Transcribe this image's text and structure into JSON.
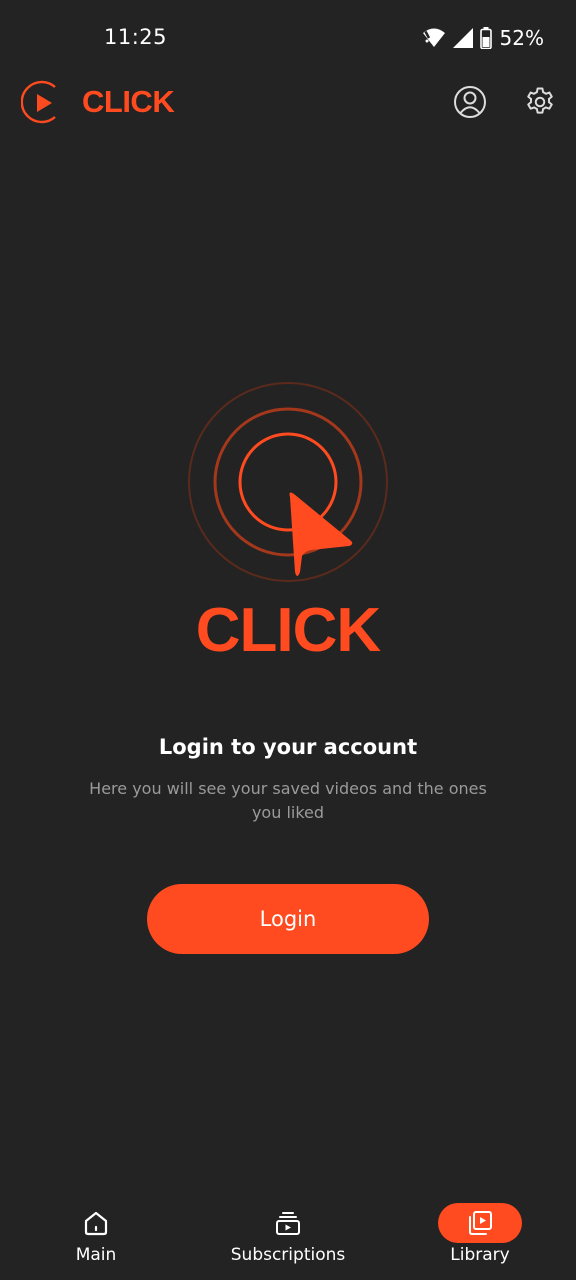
{
  "status_bar": {
    "time": "11:25",
    "battery": "52%",
    "icons": [
      "wifi-icon",
      "signal-icon",
      "battery-icon"
    ]
  },
  "header": {
    "brand": "CLICK",
    "icons": [
      "click-logo-icon",
      "profile-icon",
      "settings-gear-icon"
    ]
  },
  "hero": {
    "wordmark": "CLICK"
  },
  "login": {
    "title": "Login to your account",
    "subtitle": "Here you will see your saved videos and the ones you liked",
    "button_label": "Login"
  },
  "bottom_nav": {
    "items": [
      {
        "label": "Main",
        "icon": "home-icon",
        "active": false
      },
      {
        "label": "Subscriptions",
        "icon": "subscriptions-icon",
        "active": false
      },
      {
        "label": "Library",
        "icon": "library-icon",
        "active": true
      }
    ]
  },
  "colors": {
    "background": "#232323",
    "accent": "#ff4b1f",
    "text_primary": "#ffffff",
    "text_secondary": "#9a9a9a"
  }
}
